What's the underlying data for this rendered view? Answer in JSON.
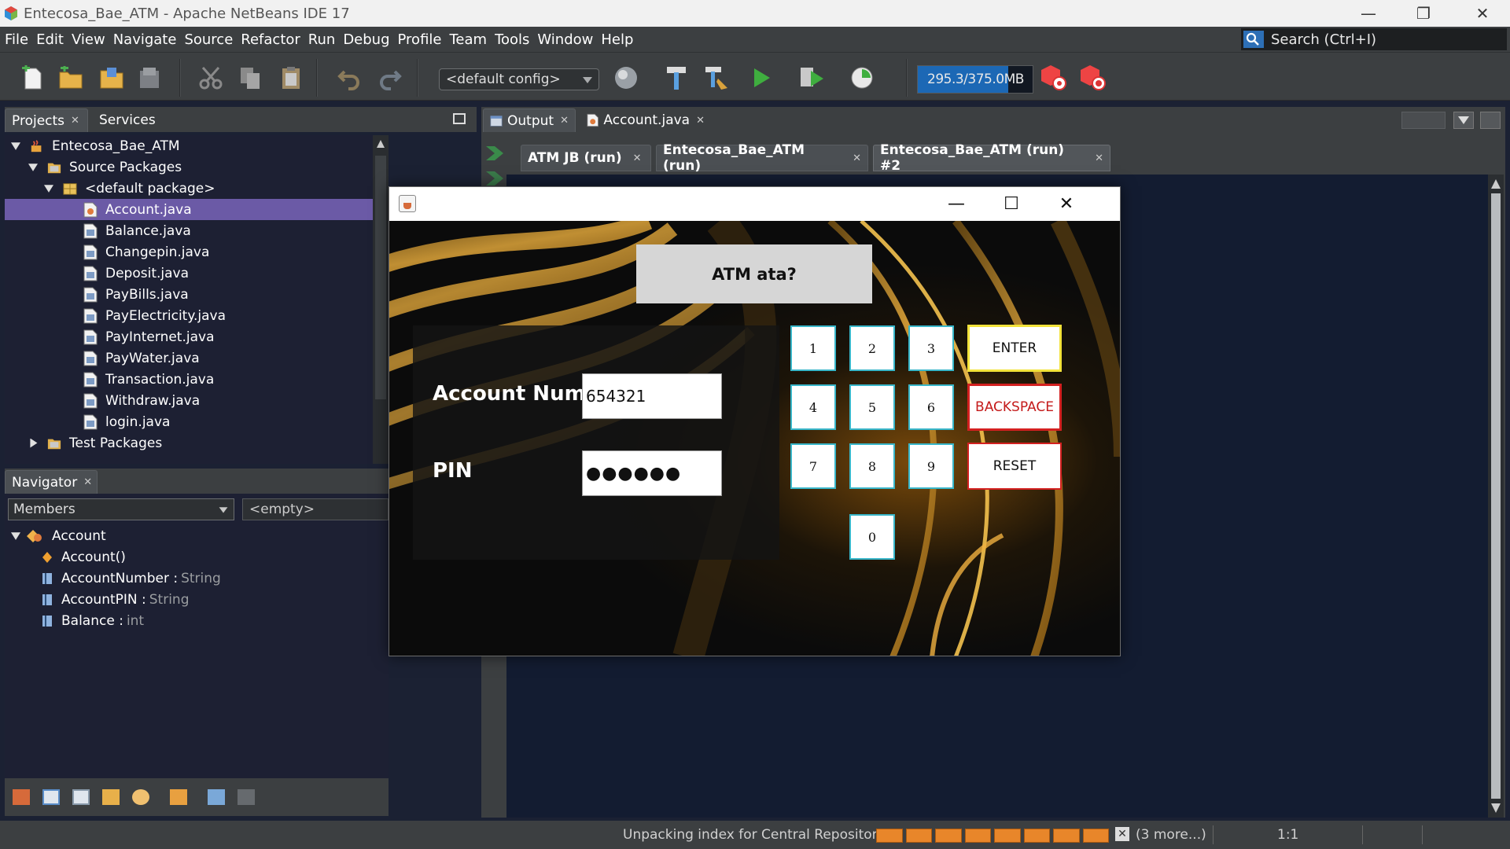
{
  "window": {
    "title": "Entecosa_Bae_ATM - Apache NetBeans IDE 17"
  },
  "menu": [
    "File",
    "Edit",
    "View",
    "Navigate",
    "Source",
    "Refactor",
    "Run",
    "Debug",
    "Profile",
    "Team",
    "Tools",
    "Window",
    "Help"
  ],
  "search": {
    "placeholder": "Search (Ctrl+I)"
  },
  "toolbar": {
    "config_value": "<default config>",
    "memory_text": "295.3/375.0MB",
    "memory_used_fraction": 0.787
  },
  "left_tabs": {
    "projects": "Projects",
    "services": "Services"
  },
  "project_tree": {
    "project": "Entecosa_Bae_ATM",
    "source_packages": "Source Packages",
    "default_package": "<default package>",
    "files": [
      "Account.java",
      "Balance.java",
      "Changepin.java",
      "Deposit.java",
      "PayBills.java",
      "PayElectricity.java",
      "PayInternet.java",
      "PayWater.java",
      "Transaction.java",
      "Withdraw.java",
      "login.java"
    ],
    "test_packages": "Test Packages"
  },
  "navigator": {
    "tab": "Navigator",
    "members_select": "Members",
    "filter_select": "<empty>",
    "class": "Account",
    "members": [
      {
        "name": "Account()",
        "type": ""
      },
      {
        "name": "AccountNumber : ",
        "type": "String"
      },
      {
        "name": "AccountPIN : ",
        "type": "String"
      },
      {
        "name": "Balance : ",
        "type": "int"
      }
    ]
  },
  "editor_tabs": {
    "output": "Output",
    "account": "Account.java"
  },
  "run_tabs": [
    "ATM JB (run)",
    "Entecosa_Bae_ATM (run)",
    "Entecosa_Bae_ATM (run) #2"
  ],
  "atm": {
    "header": "ATM ata?",
    "account_label": "Account Number",
    "account_value": "654321",
    "pin_label": "PIN",
    "pin_value": "●●●●●●",
    "keys": [
      "1",
      "2",
      "3",
      "4",
      "5",
      "6",
      "7",
      "8",
      "9",
      "0"
    ],
    "enter": "ENTER",
    "backspace": "BACKSPACE",
    "reset": "RESET"
  },
  "status": {
    "message": "Unpacking index for Central Repository",
    "more": "(3 more...)",
    "position": "1:1"
  }
}
